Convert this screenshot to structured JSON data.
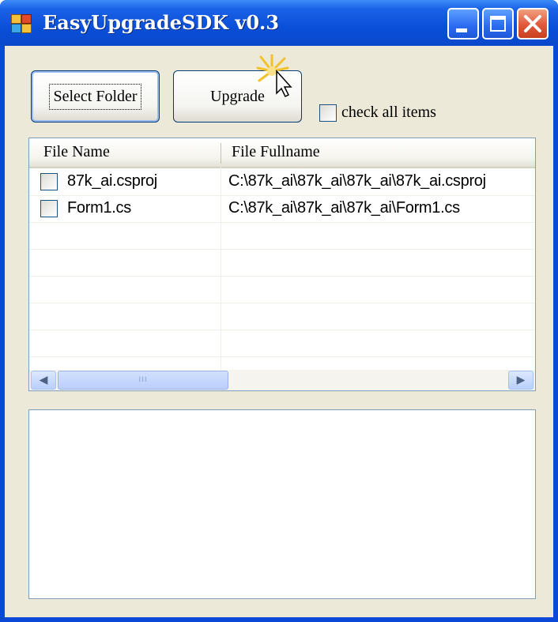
{
  "window": {
    "title": "EasyUpgradeSDK v0.3",
    "controls": {
      "minimize": "minimize-icon",
      "maximize": "maximize-icon",
      "close": "close-icon"
    }
  },
  "toolbar": {
    "select_folder_label": "Select Folder",
    "upgrade_label": "Upgrade",
    "check_all_label": "check all items"
  },
  "file_list": {
    "columns": [
      "File Name",
      "File Fullname"
    ],
    "rows": [
      {
        "checked": false,
        "name": "87k_ai.csproj",
        "fullname": "C:\\87k_ai\\87k_ai\\87k_ai\\87k_ai.csproj"
      },
      {
        "checked": false,
        "name": "Form1.cs",
        "fullname": "C:\\87k_ai\\87k_ai\\87k_ai\\Form1.cs"
      }
    ],
    "scrollbar": {
      "left_arrow": "chevron-left-icon",
      "right_arrow": "chevron-right-icon",
      "grip": "III"
    }
  },
  "log_output": "",
  "colors": {
    "titlebar": "#0a4fd8",
    "client_bg": "#ece9d8",
    "close_button": "#e0583a",
    "border": "#7f9db9"
  }
}
